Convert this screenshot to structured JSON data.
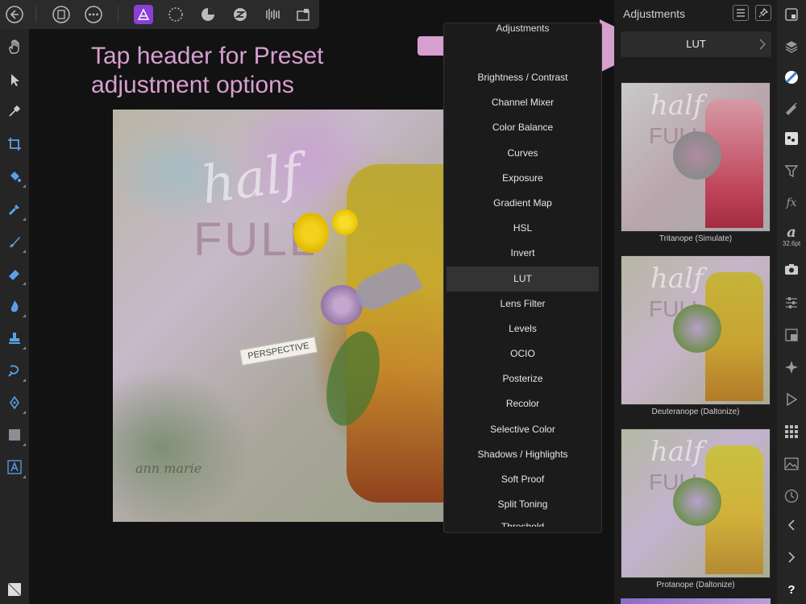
{
  "annotation": {
    "line1": "Tap header for Preset",
    "line2": "adjustment options"
  },
  "dropdown": {
    "header": "Adjustments",
    "items": [
      "Brightness / Contrast",
      "Channel Mixer",
      "Color Balance",
      "Curves",
      "Exposure",
      "Gradient Map",
      "HSL",
      "Invert",
      "LUT",
      "Lens Filter",
      "Levels",
      "OCIO",
      "Posterize",
      "Recolor",
      "Selective Color",
      "Shadows / Highlights",
      "Soft Proof",
      "Split Toning",
      "Threshold"
    ],
    "selected": "LUT"
  },
  "panel": {
    "title": "Adjustments",
    "selected_adjustment": "LUT",
    "presets": [
      {
        "caption": "Tritanope (Simulate)"
      },
      {
        "caption": "Deuteranope (Daltonize)"
      },
      {
        "caption": "Protanope (Daltonize)"
      }
    ]
  },
  "canvas": {
    "text_half": "half",
    "text_full": "FULL",
    "tag": "PERSPECTIVE",
    "signature": "ann marie"
  },
  "studiobar": {
    "font_size_readout": "32.6pt",
    "help": "?"
  },
  "colors": {
    "annotation": "#d79fd0",
    "accent_purple": "#8a3fd6",
    "selected_row": "#333333"
  }
}
